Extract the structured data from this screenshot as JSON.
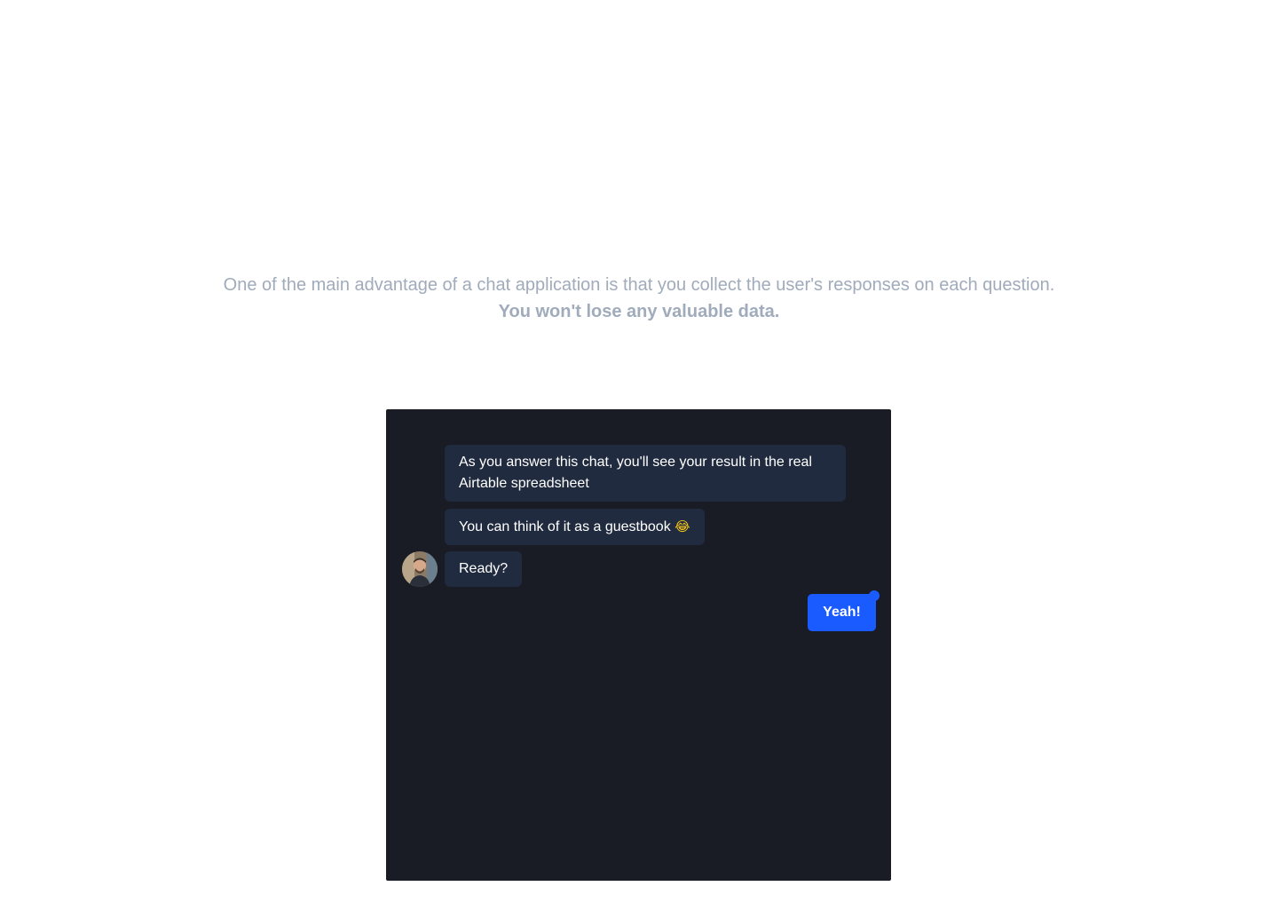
{
  "intro": {
    "line1": "One of the main advantage of a chat application is that you collect the user's responses on each question.",
    "line2": "You won't lose any valuable data."
  },
  "chat": {
    "messages": [
      {
        "text": "As you answer this chat, you'll see your result in the real Airtable spreadsheet"
      },
      {
        "text": "You can think of it as a guestbook",
        "emoji": "😂"
      },
      {
        "text": "Ready?"
      }
    ],
    "reply_label": "Yeah!"
  },
  "colors": {
    "background": "#ffffff",
    "intro_text": "#a0abbb",
    "chat_background": "#1a1c25",
    "bot_bubble": "#212b3f",
    "accent": "#1a5bff"
  }
}
